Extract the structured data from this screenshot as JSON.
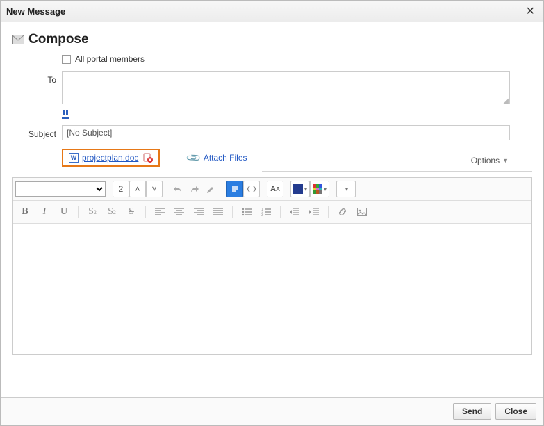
{
  "window": {
    "title": "New Message"
  },
  "header": {
    "title": "Compose"
  },
  "form": {
    "all_members_label": "All portal members",
    "to_label": "To",
    "to_value": "",
    "subject_label": "Subject",
    "subject_value": "[No Subject]"
  },
  "attachment": {
    "filename": "projectplan.doc",
    "attach_label": "Attach Files"
  },
  "options_label": "Options",
  "toolbar": {
    "font_family": "",
    "font_size": "2"
  },
  "footer": {
    "send": "Send",
    "close": "Close"
  }
}
